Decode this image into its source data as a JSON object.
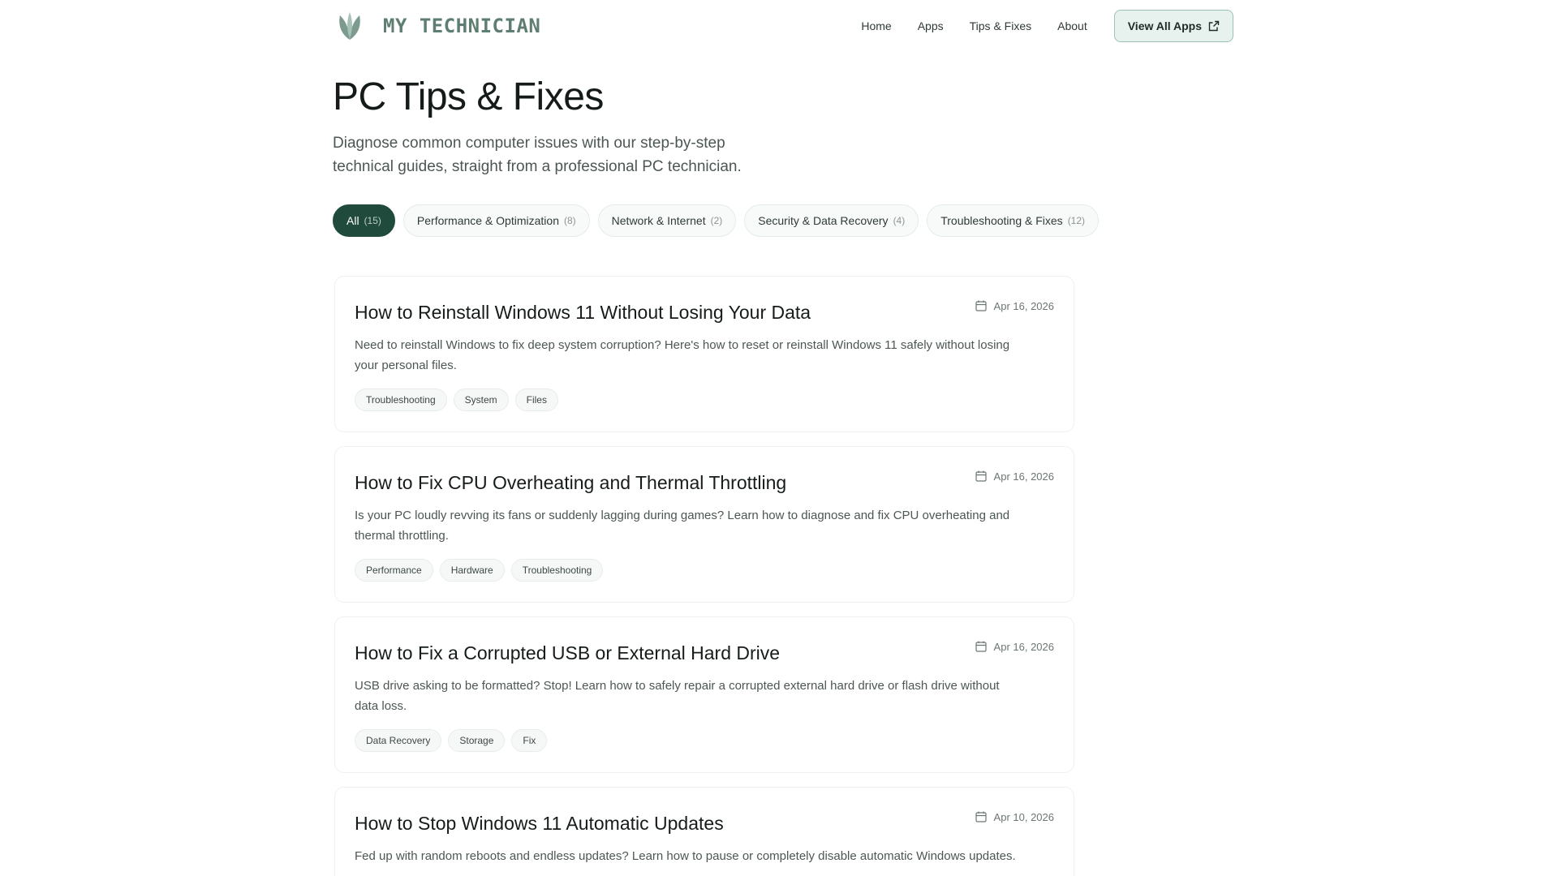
{
  "header": {
    "brand_name": "MY TECHNICIAN",
    "nav": [
      "Home",
      "Apps",
      "Tips & Fixes",
      "About"
    ],
    "cta_label": "View All Apps"
  },
  "hero": {
    "title": "PC Tips & Fixes",
    "subtitle": "Diagnose common computer issues with our step-by-step technical guides, straight from a professional PC technician."
  },
  "filters": [
    {
      "label": "All",
      "count": "(15)",
      "active": true
    },
    {
      "label": "Performance & Optimization",
      "count": "(8)"
    },
    {
      "label": "Network & Internet",
      "count": "(2)"
    },
    {
      "label": "Security & Data Recovery",
      "count": "(4)"
    },
    {
      "label": "Troubleshooting & Fixes",
      "count": "(12)"
    }
  ],
  "articles": [
    {
      "title": "How to Reinstall Windows 11 Without Losing Your Data",
      "date": "Apr 16, 2026",
      "description": "Need to reinstall Windows to fix deep system corruption? Here's how to reset or reinstall Windows 11 safely without losing your personal files.",
      "tags": [
        "Troubleshooting",
        "System",
        "Files"
      ]
    },
    {
      "title": "How to Fix CPU Overheating and Thermal Throttling",
      "date": "Apr 16, 2026",
      "description": "Is your PC loudly revving its fans or suddenly lagging during games? Learn how to diagnose and fix CPU overheating and thermal throttling.",
      "tags": [
        "Performance",
        "Hardware",
        "Troubleshooting"
      ]
    },
    {
      "title": "How to Fix a Corrupted USB or External Hard Drive",
      "date": "Apr 16, 2026",
      "description": "USB drive asking to be formatted? Stop! Learn how to safely repair a corrupted external hard drive or flash drive without data loss.",
      "tags": [
        "Data Recovery",
        "Storage",
        "Fix"
      ]
    },
    {
      "title": "How to Stop Windows 11 Automatic Updates",
      "date": "Apr 10, 2026",
      "description": "Fed up with random reboots and endless updates? Learn how to pause or completely disable automatic Windows updates.",
      "tags": []
    }
  ],
  "colors": {
    "accent_dark": "#1f4a3c",
    "brand": "#5f7e72",
    "cta_bg": "#e7f2ee"
  },
  "icons": {
    "logo": "leaf-logo-icon",
    "external": "external-link-icon",
    "date": "calendar-icon"
  }
}
